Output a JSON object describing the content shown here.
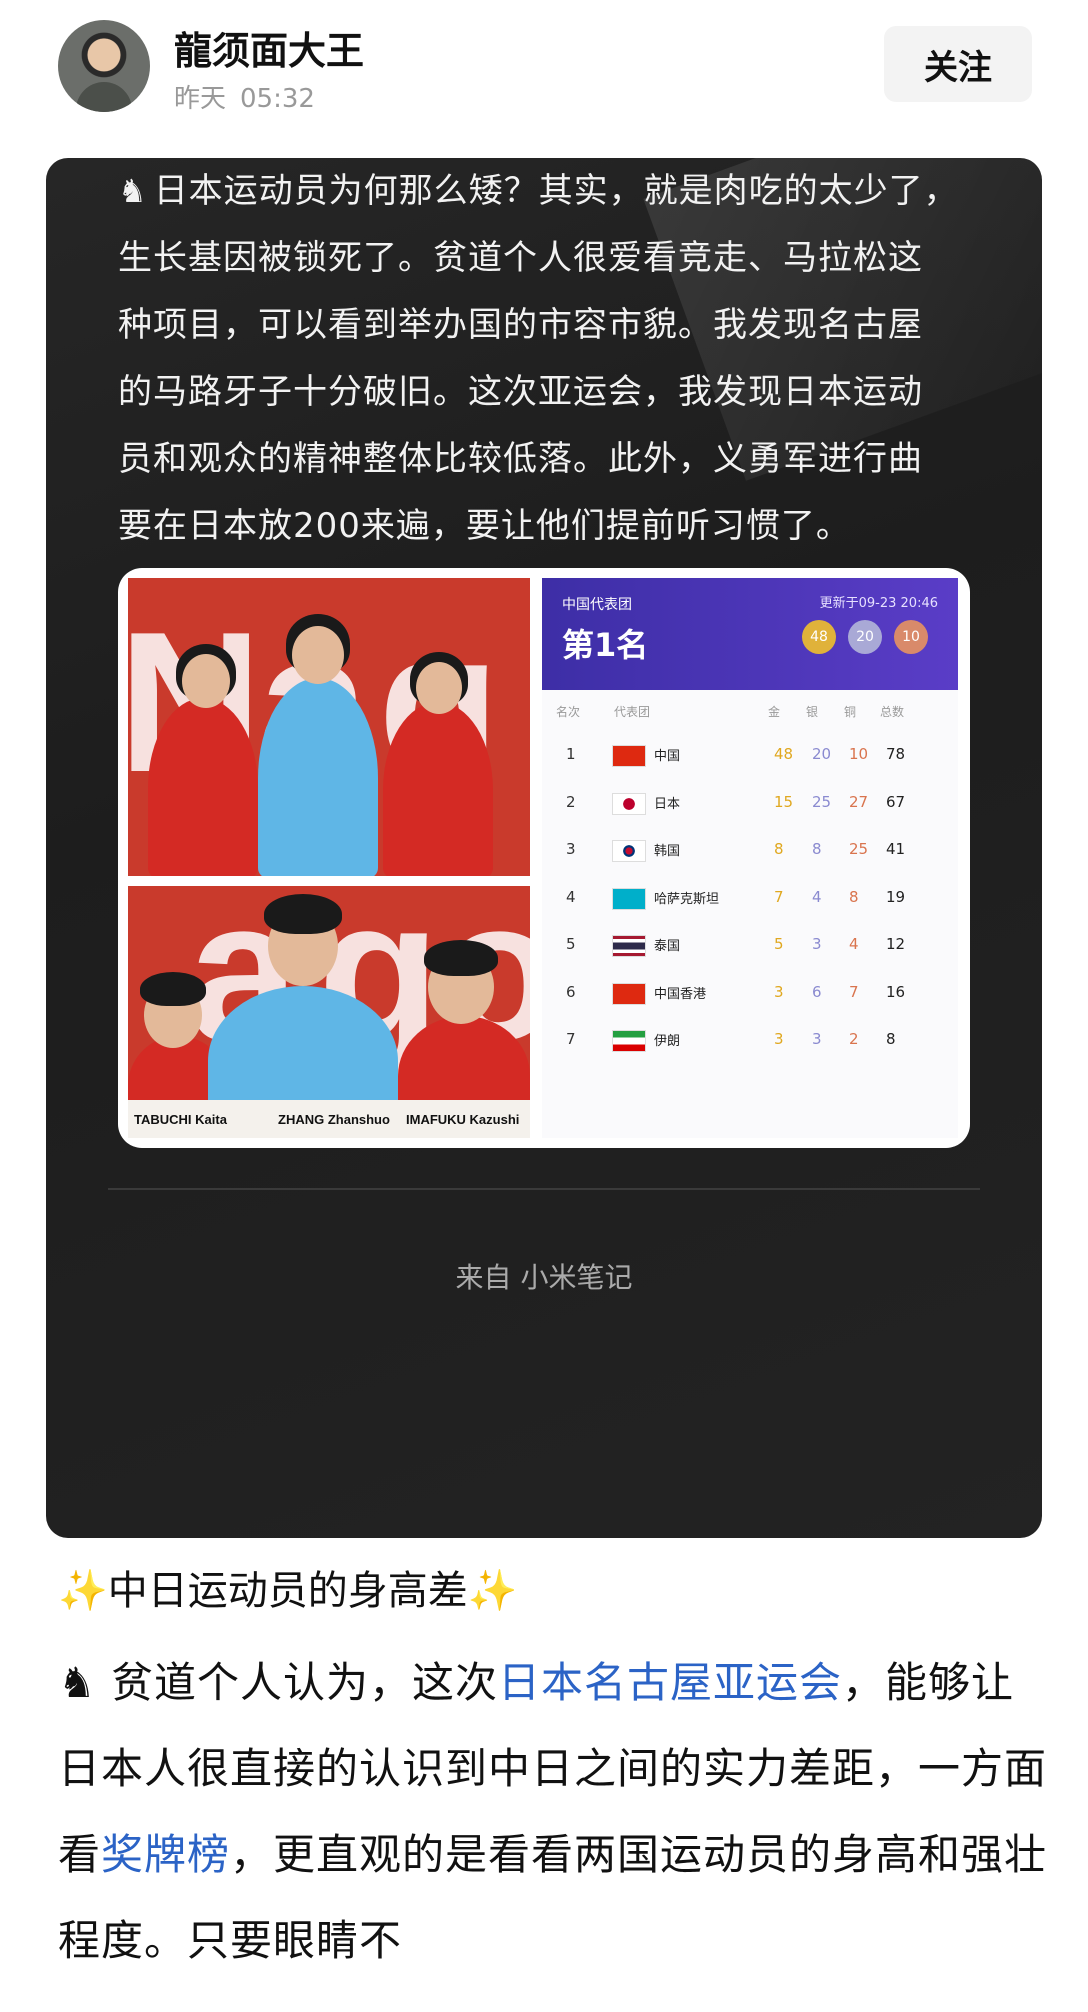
{
  "header": {
    "author": "龍须面大王",
    "time_day": "昨天",
    "time_clock": "05:32",
    "follow_label": "关注"
  },
  "card": {
    "text_lines": [
      "日本运动员为何那么矮？其实，就是肉吃的太少了，",
      "生长基因被锁死了。贫道个人很爱看竞走、马拉松这",
      "种项目，可以看到举办国的市容市貌。我发现名古屋",
      "的马路牙子十分破旧。这次亚运会，我发现日本运动",
      "员和观众的精神整体比较低落。此外，义勇军进行曲",
      "要在日本放200来遍，要让他们提前听习惯了。"
    ],
    "knight_icon": "♞",
    "photo_letters": [
      "N",
      "a",
      "g",
      "o"
    ],
    "name_plates": [
      "TABUCHI Kaita",
      "ZHANG Zhanshuo",
      "IMAFUKU Kazushi"
    ],
    "medal_table": {
      "team_label": "中国代表团",
      "updated": "更新于09-23 20:46",
      "rank_title": "第1名",
      "gold": "48",
      "silver": "20",
      "bronze": "10",
      "columns": [
        "名次",
        "代表团",
        "金",
        "银",
        "铜",
        "总数"
      ],
      "rows": [
        {
          "rank": "1",
          "name": "中国",
          "gold": "48",
          "silver": "20",
          "bronze": "10",
          "total": "78"
        },
        {
          "rank": "2",
          "name": "日本",
          "gold": "15",
          "silver": "25",
          "bronze": "27",
          "total": "67"
        },
        {
          "rank": "3",
          "name": "韩国",
          "gold": "8",
          "silver": "8",
          "bronze": "25",
          "total": "41"
        },
        {
          "rank": "4",
          "name": "哈萨克斯坦",
          "gold": "7",
          "silver": "4",
          "bronze": "8",
          "total": "19"
        },
        {
          "rank": "5",
          "name": "泰国",
          "gold": "5",
          "silver": "3",
          "bronze": "4",
          "total": "12"
        },
        {
          "rank": "6",
          "name": "中国香港",
          "gold": "3",
          "silver": "6",
          "bronze": "7",
          "total": "16"
        },
        {
          "rank": "7",
          "name": "伊朗",
          "gold": "3",
          "silver": "3",
          "bronze": "2",
          "total": "8"
        }
      ]
    },
    "source": "来自 小米笔记"
  },
  "article": {
    "subtitle": "✨中日运动员的身高差✨",
    "p_part1": "贫道个人认为，这次",
    "p_link1": "日本名古屋亚运会",
    "p_part2": "，能够让日本人很直接的认识到中日之间的实力差距，一方面看",
    "p_link2": "奖牌榜",
    "p_part3": "，更直观的是看看两国运动员的身高和强壮程度。只要眼睛不"
  },
  "colors": {
    "card_bg": "#1f1f1f",
    "link": "#2b63c6",
    "medal_header": "#4a33b5",
    "gold": "#e0b23a",
    "silver": "#a9a9d6",
    "bronze": "#d98a6a"
  }
}
